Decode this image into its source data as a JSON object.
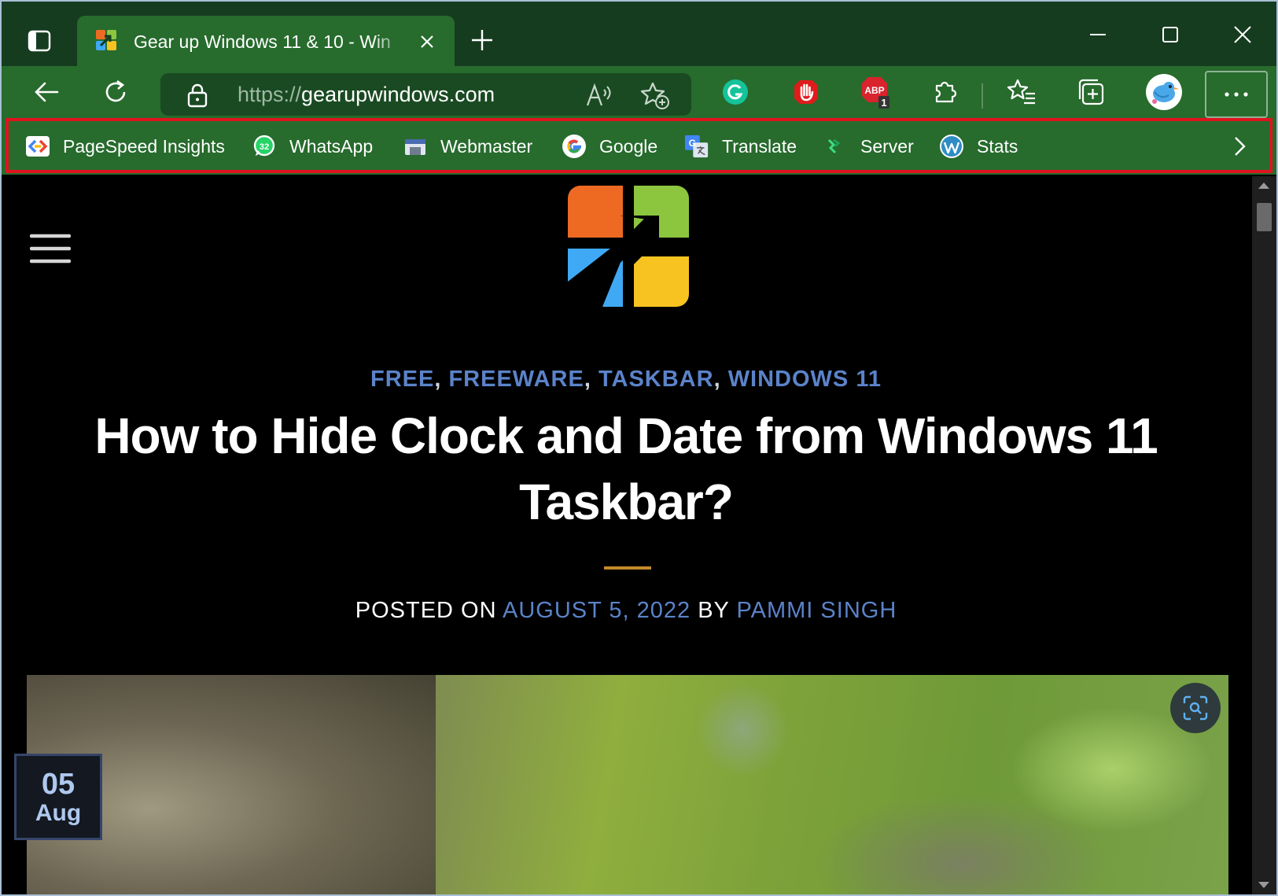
{
  "browser": {
    "tab": {
      "title": "Gear up Windows 11 & 10 - Win"
    },
    "address": {
      "protocol": "https://",
      "host": "gearupwindows.com"
    },
    "extensions": {
      "abp_badge": "1",
      "abp_label": "ABP"
    }
  },
  "favorites": [
    {
      "label": "PageSpeed Insights",
      "icon": "pagespeed-icon"
    },
    {
      "label": "WhatsApp",
      "icon": "whatsapp-icon",
      "badge": "32"
    },
    {
      "label": "Webmaster",
      "icon": "webmaster-icon"
    },
    {
      "label": "Google",
      "icon": "google-icon"
    },
    {
      "label": "Translate",
      "icon": "translate-icon"
    },
    {
      "label": "Server",
      "icon": "server-icon"
    },
    {
      "label": "Stats",
      "icon": "wordpress-icon"
    }
  ],
  "article": {
    "categories": [
      "FREE",
      "FREEWARE",
      "TASKBAR",
      "WINDOWS 11"
    ],
    "title": "How to Hide Clock and Date from Windows 11 Taskbar?",
    "posted_on_label": "POSTED ON",
    "date": "AUGUST 5, 2022",
    "by_label": "BY",
    "author": "PAMMI SINGH",
    "badge_day": "05",
    "badge_month": "Aug"
  },
  "colors": {
    "tab_strip": "#163c1f",
    "toolbar": "#276b2d",
    "link": "#5b83c9",
    "highlight": "#e0141e"
  }
}
